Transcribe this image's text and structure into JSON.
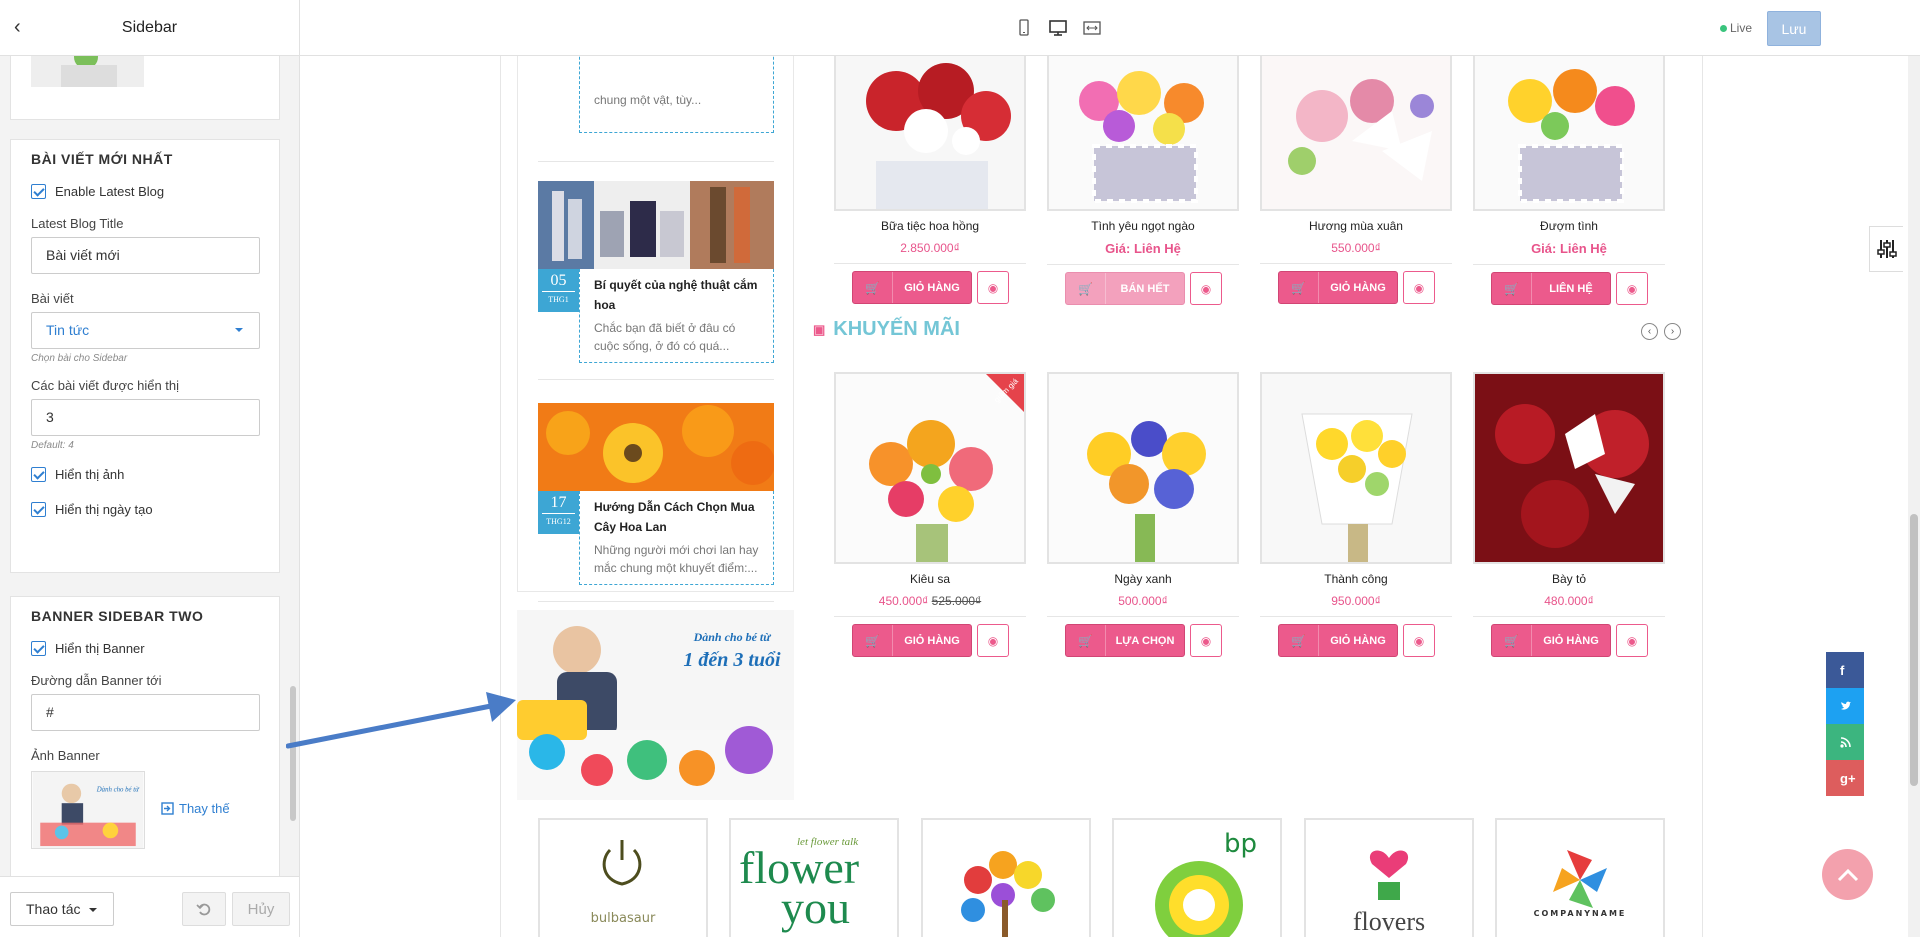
{
  "header": {
    "title": "Sidebar",
    "live_label": "Live",
    "save_label": "Lưu"
  },
  "sidebar": {
    "latest": {
      "heading": "BÀI VIẾT MỚI NHẤT",
      "enable_label": "Enable Latest Blog",
      "title_label": "Latest Blog Title",
      "title_value": "Bài viết mới",
      "posts_label": "Bài viết",
      "posts_value": "Tin tức",
      "posts_hint": "Chọn bài cho Sidebar",
      "count_label": "Các bài viết được hiển thị",
      "count_value": "3",
      "count_hint": "Default: 4",
      "show_image": "Hiển thị ảnh",
      "show_date": "Hiển thị ngày tạo"
    },
    "banner": {
      "heading": "BANNER SIDEBAR TWO",
      "show_label": "Hiển thị Banner",
      "link_label": "Đường dẫn Banner tới",
      "link_value": "#",
      "image_label": "Ảnh Banner",
      "replace_label": "Thay thế"
    }
  },
  "footer": {
    "actions_label": "Thao tác",
    "cancel_label": "Hủy"
  },
  "blog": {
    "post0": {
      "snippet": "chung một vật, tùy..."
    },
    "post1": {
      "day": "05",
      "month": "THG1",
      "title": "Bí quyết của nghệ thuật cắm hoa",
      "snippet": "Chắc bạn đã biết ở đâu có cuộc sống, ở đó có quá..."
    },
    "post2": {
      "day": "17",
      "month": "THG12",
      "title": "Hướng Dẫn Cách Chọn Mua Cây Hoa Lan",
      "snippet": "Những người mới chơi lan hay mắc chung một khuyết điểm:..."
    }
  },
  "banner_text": {
    "line1": "Dành cho bé từ",
    "line2": "1 đến 3 tuổi"
  },
  "products_top": [
    {
      "name": "Bữa tiệc hoa hồng",
      "price": "2.850.000₫",
      "button": "GIỎ HÀNG"
    },
    {
      "name": "Tình yêu ngọt ngào",
      "price": "Giá: Liên Hệ",
      "button": "BÁN HẾT"
    },
    {
      "name": "Hương mùa xuân",
      "price": "550.000₫",
      "button": "GIỎ HÀNG"
    },
    {
      "name": "Đượm tình",
      "price": "Giá: Liên Hệ",
      "button": "LIÊN HỆ"
    }
  ],
  "promo": {
    "title": "KHUYẾN MÃI",
    "badge": "giảm giá"
  },
  "products_promo": [
    {
      "name": "Kiêu sa",
      "price": "450.000₫",
      "old_price": "525.000₫",
      "button": "GIỎ HÀNG"
    },
    {
      "name": "Ngày xanh",
      "price": "500.000₫",
      "old_price": "",
      "button": "LỰA CHỌN"
    },
    {
      "name": "Thành công",
      "price": "950.000₫",
      "old_price": "",
      "button": "GIỎ HÀNG"
    },
    {
      "name": "Bày tỏ",
      "price": "480.000₫",
      "old_price": "",
      "button": "GIỎ HÀNG"
    }
  ],
  "brands": {
    "b1": "bulbasaur",
    "b2_small": "let flower talk",
    "b2": "flower",
    "b2b": "you",
    "b4": "bp",
    "b5": "flovers",
    "b6": "COMPANYNAME"
  },
  "social": {
    "f": "f",
    "g": "g+"
  },
  "colors": {
    "accent": "#ec5a8c",
    "blue": "#2f7fd1",
    "teal": "#74c6d6",
    "date": "#3da6d4"
  }
}
